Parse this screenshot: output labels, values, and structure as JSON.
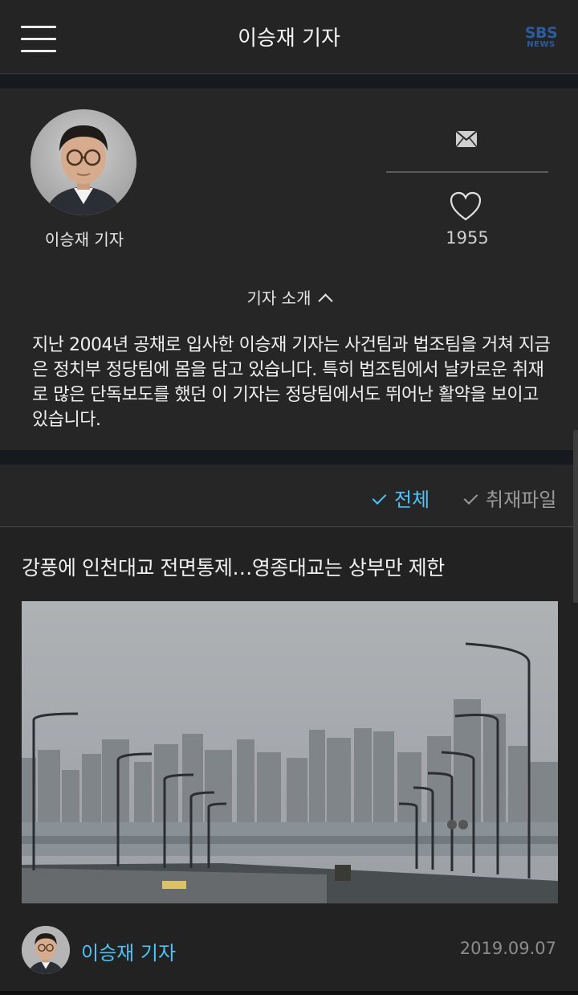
{
  "header": {
    "title": "이승재 기자",
    "menu_icon": "hamburger-menu-icon",
    "logo_line1": "SBS",
    "logo_line2": "NEWS",
    "logo_color": "#2a5d9e"
  },
  "profile": {
    "name": "이승재 기자",
    "email_icon": "mail-icon",
    "like_icon": "heart-icon",
    "like_count": "1955",
    "intro_toggle_label": "기자 소개",
    "intro_text": "지난 2004년 공채로 입사한 이승재 기자는 사건팀과 법조팀을 거쳐 지금은 정치부 정당팀에 몸을 담고 있습니다. 특히 법조팀에서 날카로운 취재로 많은 단독보도를 했던 이 기자는 정당팀에서도 뛰어난 활약을 보이고 있습니다."
  },
  "tabs": {
    "all_label": "전체",
    "files_label": "취재파일",
    "active": "전체",
    "accent_color": "#4fc3f7"
  },
  "articles": [
    {
      "title": "강풍에 인천대교 전면통제…영종대교는 상부만 제한",
      "author": "이승재 기자",
      "date": "2019.09.07"
    }
  ]
}
